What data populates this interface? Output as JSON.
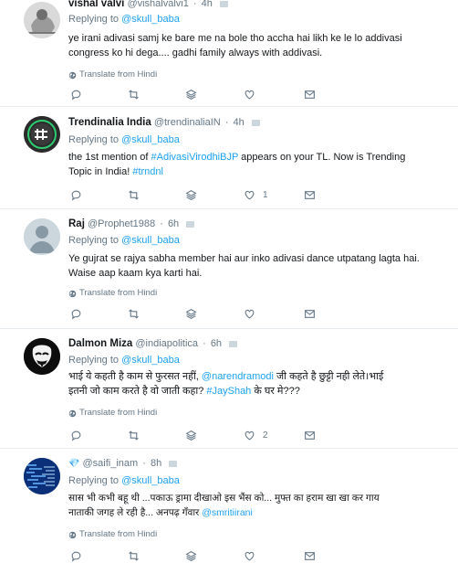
{
  "translate_label": "Translate from Hindi",
  "tweets": [
    {
      "name": "vishal valvi",
      "handle": "@vishalvalvi1",
      "time": "4h",
      "replying_prefix": "Replying to ",
      "replying_to": "@skull_baba",
      "text_lines": [
        "ye irani adivasi samj ke bare me na bole tho accha hai likh ke le lo addivasi",
        "congress ko hi dega.... gadhi family always with addivasi."
      ],
      "translate": true,
      "likes": ""
    },
    {
      "name": "Trendinalia India",
      "handle": "@trendinaliaIN",
      "time": "4h",
      "replying_prefix": "Replying to ",
      "replying_to": "@skull_baba",
      "text_parts": {
        "p1": "the 1st mention of ",
        "hashtag1": "#AdivasiVirodhiBJP",
        "p2": " appears on your TL. Now is Trending",
        "p3": "Topic in India! ",
        "hashtag2": "#trndnl"
      },
      "translate": false,
      "likes": "1"
    },
    {
      "name": "Raj",
      "handle": "@Prophet1988",
      "time": "6h",
      "replying_prefix": "Replying to ",
      "replying_to": "@skull_baba",
      "text_lines": [
        "Ye gujrat se rajya sabha member hai aur inko adivasi dance utpatang lagta hai.",
        "Waise aap kaam kya karti hai."
      ],
      "translate": true,
      "likes": ""
    },
    {
      "name": "Dalmon Miza",
      "handle": "@indiapolitica",
      "time": "6h",
      "replying_prefix": "Replying to ",
      "replying_to": "@skull_baba",
      "text_parts": {
        "p1": "भाई ये कहती है काम से फुरसत नहीं, ",
        "mention": "@narendramodi",
        "p2": " जी कहते है छुट्टी नही लेते।भाई",
        "p3": "इतनी जो काम करते है वो जाती कहा? ",
        "hashtag": "#JayShah",
        "p4": " के घर मे???"
      },
      "translate": true,
      "likes": "2"
    },
    {
      "name": "",
      "handle": "@saifi_inam",
      "time": "8h",
      "name_emoji": "💎",
      "replying_prefix": "Replying to ",
      "replying_to": "@skull_baba",
      "text_parts": {
        "l1": "सास भी कभी बहू थी ...पकाऊ ड्रामा दीखाओ इस भैंस को... मुफ्त का हराम खा खा कर गाय",
        "l2": "नाताकी जगह ले रही है... अनपढ़ गँवार ",
        "mention": "@smritiirani"
      },
      "translate": true,
      "likes": ""
    }
  ],
  "icons": {
    "reply": "reply-icon",
    "retweet": "retweet-icon",
    "stack": "stack-icon",
    "like": "heart-icon",
    "message": "mail-icon",
    "translate": "globe-icon"
  },
  "colors": {
    "accent": "#1da1f2",
    "muted": "#657786",
    "border": "#e6ecf0"
  }
}
